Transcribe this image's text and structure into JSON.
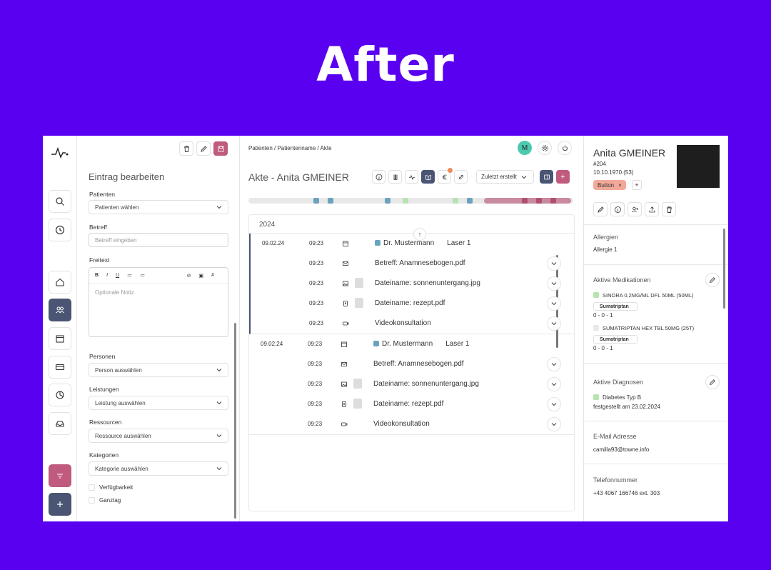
{
  "hero": {
    "title": "After"
  },
  "form": {
    "title": "Eintrag bearbeiten",
    "patienten_label": "Patienten",
    "patienten_value": "Patienten wählen",
    "betreff_label": "Betreff",
    "betreff_placeholder": "Betreff eingeben",
    "freitext_label": "Freitext",
    "editor_tools": [
      "B",
      "I",
      "U",
      "≔",
      "≔",
      "⊘",
      "▣",
      "#"
    ],
    "freitext_placeholder": "Optionale Notiz",
    "personen_label": "Personen",
    "personen_value": "Person auswählen",
    "leistungen_label": "Leistungen",
    "leistungen_value": "Leistung auswählen",
    "ressourcen_label": "Ressourcen",
    "ressourcen_value": "Ressource auswählen",
    "kategorien_label": "Kategorien",
    "kategorien_value": "Kategorie auswählen",
    "check_verfuegbarkeit": "Verfügbarkeit",
    "check_ganztag": "Ganztag"
  },
  "main": {
    "breadcrumb": "Patienten / Patientenname / Akte",
    "avatar_initial": "M",
    "title": "Akte - Anita GMEINER",
    "sort_label": "Zuletzt erstellt",
    "add_label": "+",
    "year": "2024",
    "groups": [
      {
        "rows": [
          {
            "date": "09.02.24",
            "time": "09:23",
            "icon": "calendar-icon",
            "doctor": "Dr. Mustermann",
            "sub": "Laser 1"
          },
          {
            "date": "",
            "time": "09:23",
            "icon": "mail-icon",
            "text": "Betreff: Anamnesebogen.pdf"
          },
          {
            "date": "",
            "time": "09:23",
            "icon": "image-icon",
            "text": "Dateiname: sonnenuntergang.jpg"
          },
          {
            "date": "",
            "time": "09:23",
            "icon": "pdf-icon",
            "text": "Dateiname: rezept.pdf"
          },
          {
            "date": "",
            "time": "09:23",
            "icon": "video-icon",
            "text": "Videokonsultation"
          }
        ]
      },
      {
        "rows": [
          {
            "date": "09.02.24",
            "time": "09:23",
            "icon": "calendar-icon",
            "doctor": "Dr. Mustermann",
            "sub": "Laser 1"
          },
          {
            "date": "",
            "time": "09:23",
            "icon": "mail-icon",
            "text": "Betreff: Anamnesebogen.pdf"
          },
          {
            "date": "",
            "time": "09:23",
            "icon": "image-icon",
            "text": "Dateiname: sonnenuntergang.jpg"
          },
          {
            "date": "",
            "time": "09:23",
            "icon": "pdf-icon",
            "text": "Dateiname: rezept.pdf"
          },
          {
            "date": "",
            "time": "09:23",
            "icon": "video-icon",
            "text": "Videokonsultation"
          }
        ]
      }
    ]
  },
  "patient": {
    "name": "Anita GMEINER",
    "id": "#204",
    "dob": "10.10.1970 (53)",
    "badge": "Button",
    "badge_close": "×",
    "add": "+",
    "allergien_title": "Allergien",
    "allergien_value": "Allergie 1",
    "medikationen_title": "Aktive Medikationen",
    "med1_name": "SINORA 0,2MG/ML DFL 50ML (50ML)",
    "med1_tag": "Sumatriptan",
    "med1_dose": "0 - 0 - 1",
    "med2_name": "SUMATRIPTAN HEX TBL 50MG (25T)",
    "med2_tag": "Sumatriptan",
    "med2_dose": "0 - 0 - 1",
    "diagnosen_title": "Aktive Diagnosen",
    "diagnose_name": "Diabetes Typ B",
    "diagnose_date": "festgestellt am 23.02.2024",
    "email_title": "E-Mail Adresse",
    "email_value": "camilla93@towne.info",
    "tel_title": "Telefonnummer",
    "tel_value": "+43 4067 166746 ext. 303"
  },
  "colors": {
    "background": "#5a00f0",
    "accent_dark": "#4a5573",
    "accent_pink": "#c05a7e",
    "avatar": "#4dc9b0",
    "doc_blue": "#6aa3c0",
    "med_green": "#b6e3b0"
  }
}
